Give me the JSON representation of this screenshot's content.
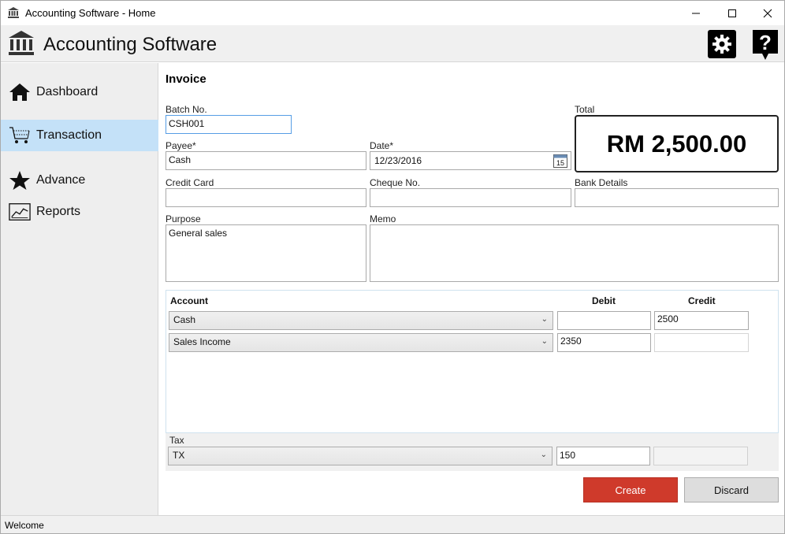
{
  "window": {
    "title": "Accounting Software - Home"
  },
  "header": {
    "app_name": "Accounting Software",
    "icons": [
      "bank-icon",
      "gear-icon",
      "help-icon"
    ]
  },
  "sidebar": {
    "items": [
      {
        "label": "Dashboard",
        "icon": "home-icon",
        "active": false
      },
      {
        "label": "Transaction",
        "icon": "cart-icon",
        "active": true
      },
      {
        "label": "Advance",
        "icon": "star-icon",
        "active": false
      },
      {
        "label": "Reports",
        "icon": "chart-icon",
        "active": false
      }
    ],
    "active_color": "#c4e1f8"
  },
  "form": {
    "section_title": "Invoice",
    "batch_no": {
      "label": "Batch No.",
      "value": "CSH001"
    },
    "total": {
      "label": "Total",
      "value": "RM 2,500.00"
    },
    "payee": {
      "label": "Payee*",
      "value": "Cash"
    },
    "date": {
      "label": "Date*",
      "value": "12/23/2016",
      "calendar_day": "15"
    },
    "credit_card": {
      "label": "Credit Card",
      "value": ""
    },
    "cheque_no": {
      "label": "Cheque No.",
      "value": ""
    },
    "bank_details": {
      "label": "Bank Details",
      "value": ""
    },
    "purpose": {
      "label": "Purpose",
      "value": "General sales"
    },
    "memo": {
      "label": "Memo",
      "value": ""
    }
  },
  "grid": {
    "headers": {
      "account": "Account",
      "debit": "Debit",
      "credit": "Credit"
    },
    "rows": [
      {
        "account": "Cash",
        "debit": "",
        "credit": "2500"
      },
      {
        "account": "Sales Income",
        "debit": "2350",
        "credit": ""
      }
    ]
  },
  "tax": {
    "label": "Tax",
    "code": "TX",
    "debit": "150",
    "credit": ""
  },
  "buttons": {
    "create": "Create",
    "discard": "Discard"
  },
  "colors": {
    "create_button": "#cf3a2b",
    "focus_border": "#569de5"
  },
  "status": {
    "text": "Welcome"
  }
}
